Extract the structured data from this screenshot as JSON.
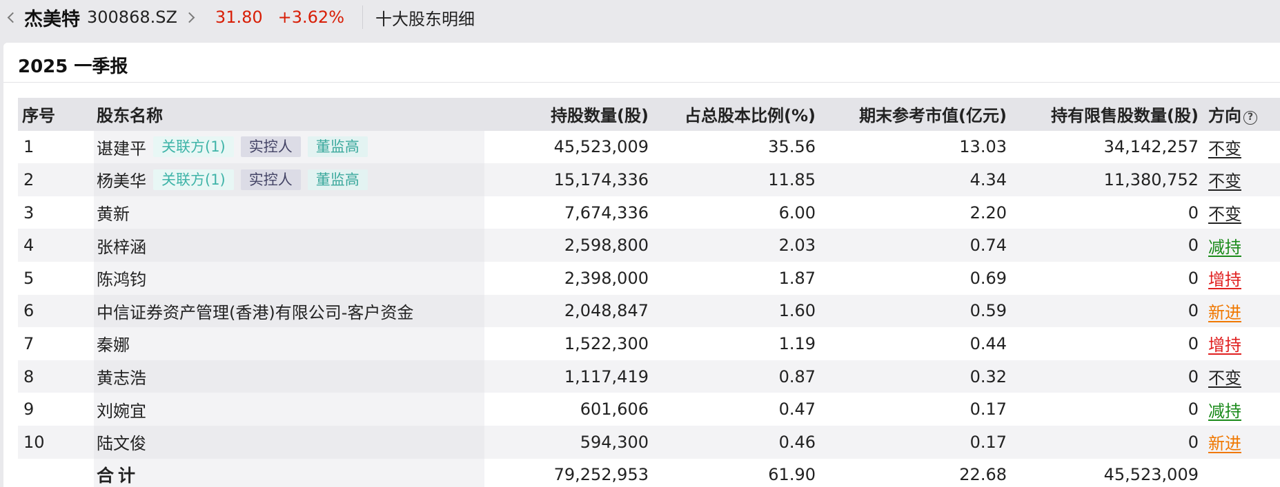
{
  "header": {
    "stock_name": "杰美特",
    "stock_code": "300868.SZ",
    "price": "31.80",
    "change": "+3.62%",
    "page_name": "十大股东明细"
  },
  "report": {
    "title": "2025 一季报"
  },
  "columns": {
    "idx": "序号",
    "name": "股东名称",
    "shares": "持股数量(股)",
    "pct": "占总股本比例(%)",
    "mv": "期末参考市值(亿元)",
    "restricted": "持有限售股数量(股)",
    "direction": "方向"
  },
  "rows": [
    {
      "idx": "1",
      "name": "谌建平",
      "tags": [
        "关联方(1)",
        "实控人",
        "董监高"
      ],
      "shares": "45,523,009",
      "pct": "35.56",
      "mv": "13.03",
      "restricted": "34,142,257",
      "direction": "不变",
      "dir_color": "#222222"
    },
    {
      "idx": "2",
      "name": "杨美华",
      "tags": [
        "关联方(1)",
        "实控人",
        "董监高"
      ],
      "shares": "15,174,336",
      "pct": "11.85",
      "mv": "4.34",
      "restricted": "11,380,752",
      "direction": "不变",
      "dir_color": "#222222"
    },
    {
      "idx": "3",
      "name": "黄新",
      "tags": [],
      "shares": "7,674,336",
      "pct": "6.00",
      "mv": "2.20",
      "restricted": "0",
      "direction": "不变",
      "dir_color": "#222222"
    },
    {
      "idx": "4",
      "name": "张梓涵",
      "tags": [],
      "shares": "2,598,800",
      "pct": "2.03",
      "mv": "0.74",
      "restricted": "0",
      "direction": "减持",
      "dir_color": "#1a8a1a"
    },
    {
      "idx": "5",
      "name": "陈鸿钧",
      "tags": [],
      "shares": "2,398,000",
      "pct": "1.87",
      "mv": "0.69",
      "restricted": "0",
      "direction": "增持",
      "dir_color": "#e01e1e"
    },
    {
      "idx": "6",
      "name": "中信证券资产管理(香港)有限公司-客户资金",
      "tags": [],
      "shares": "2,048,847",
      "pct": "1.60",
      "mv": "0.59",
      "restricted": "0",
      "direction": "新进",
      "dir_color": "#f07800"
    },
    {
      "idx": "7",
      "name": "秦娜",
      "tags": [],
      "shares": "1,522,300",
      "pct": "1.19",
      "mv": "0.44",
      "restricted": "0",
      "direction": "增持",
      "dir_color": "#e01e1e"
    },
    {
      "idx": "8",
      "name": "黄志浩",
      "tags": [],
      "shares": "1,117,419",
      "pct": "0.87",
      "mv": "0.32",
      "restricted": "0",
      "direction": "不变",
      "dir_color": "#222222"
    },
    {
      "idx": "9",
      "name": "刘婉宜",
      "tags": [],
      "shares": "601,606",
      "pct": "0.47",
      "mv": "0.17",
      "restricted": "0",
      "direction": "减持",
      "dir_color": "#1a8a1a"
    },
    {
      "idx": "10",
      "name": "陆文俊",
      "tags": [],
      "shares": "594,300",
      "pct": "0.46",
      "mv": "0.17",
      "restricted": "0",
      "direction": "新进",
      "dir_color": "#f07800"
    }
  ],
  "total": {
    "label": "合计",
    "shares": "79,252,953",
    "pct": "61.90",
    "mv": "22.68",
    "restricted": "45,523,009"
  },
  "tag_styles": {
    "关联方(1)": "related",
    "实控人": "controller",
    "董监高": "board"
  }
}
